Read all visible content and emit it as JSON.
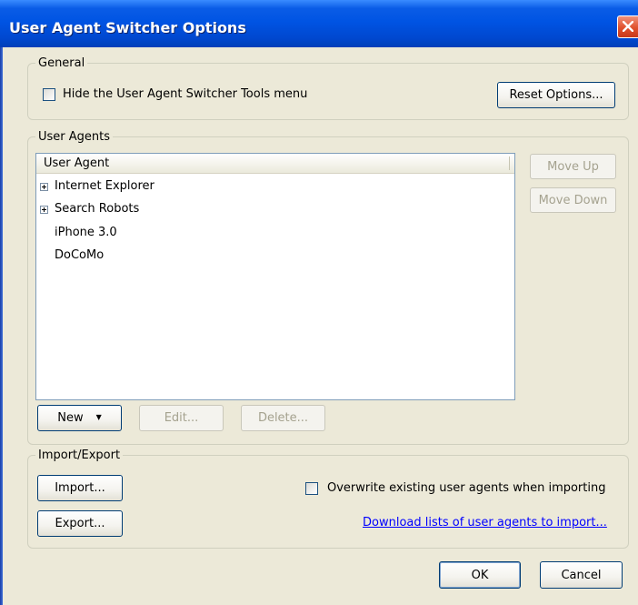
{
  "window": {
    "title": "User Agent Switcher Options"
  },
  "general": {
    "legend": "General",
    "hide_menu_label": "Hide the User Agent Switcher Tools menu",
    "hide_menu_checked": false,
    "reset_button": "Reset Options..."
  },
  "agents": {
    "legend": "User Agents",
    "column_header": "User Agent",
    "items": [
      {
        "label": "Internet Explorer",
        "expandable": true
      },
      {
        "label": "Search Robots",
        "expandable": true
      },
      {
        "label": "iPhone 3.0",
        "expandable": false
      },
      {
        "label": "DoCoMo",
        "expandable": false
      }
    ],
    "move_up_button": "Move Up",
    "move_down_button": "Move Down",
    "new_button": "New",
    "edit_button": "Edit...",
    "delete_button": "Delete..."
  },
  "import_export": {
    "legend": "Import/Export",
    "import_button": "Import...",
    "export_button": "Export...",
    "overwrite_label": "Overwrite existing user agents when importing",
    "overwrite_checked": false,
    "download_link": "Download lists of user agents to import..."
  },
  "dialog": {
    "ok_button": "OK",
    "cancel_button": "Cancel"
  },
  "icons": {
    "close": "close-icon",
    "expand": "plus-expander-icon",
    "dropdown": "dropdown-arrow-icon"
  }
}
